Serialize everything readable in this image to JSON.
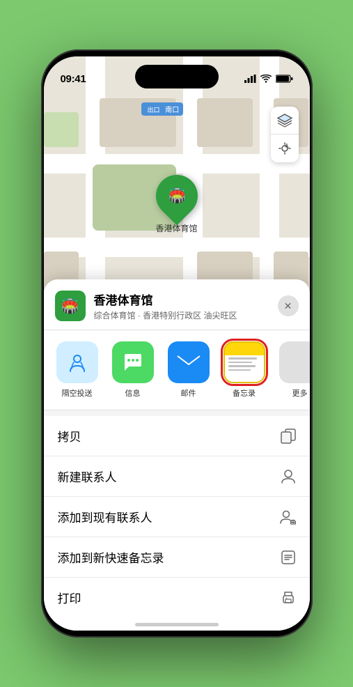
{
  "status_bar": {
    "time": "09:41",
    "location_arrow": true
  },
  "map": {
    "label": "南口",
    "label_prefix": "出口"
  },
  "pin": {
    "label": "香港体育馆"
  },
  "sheet": {
    "venue_name": "香港体育馆",
    "venue_subtitle": "综合体育馆 · 香港特别行政区 油尖旺区",
    "close_label": "×"
  },
  "share_items": [
    {
      "id": "airdrop",
      "label": "隔空投送",
      "icon": "📡",
      "style": "airdrop"
    },
    {
      "id": "messages",
      "label": "信息",
      "icon": "💬",
      "style": "messages"
    },
    {
      "id": "mail",
      "label": "邮件",
      "icon": "✉️",
      "style": "mail"
    },
    {
      "id": "notes",
      "label": "备忘录",
      "icon": "notes",
      "style": "notes",
      "selected": true
    },
    {
      "id": "more",
      "label": "更多",
      "icon": "⋯",
      "style": "more"
    }
  ],
  "actions": [
    {
      "id": "copy",
      "label": "拷贝",
      "icon": "📋"
    },
    {
      "id": "new-contact",
      "label": "新建联系人",
      "icon": "👤"
    },
    {
      "id": "add-to-contact",
      "label": "添加到现有联系人",
      "icon": "👤+"
    },
    {
      "id": "quick-note",
      "label": "添加到新快速备忘录",
      "icon": "📝"
    },
    {
      "id": "print",
      "label": "打印",
      "icon": "🖨️"
    }
  ]
}
